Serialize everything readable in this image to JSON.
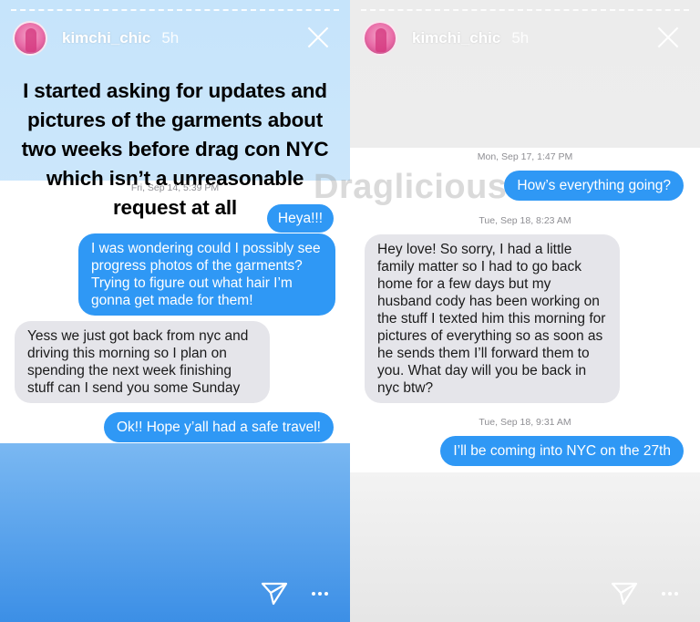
{
  "left": {
    "username": "kimchi_chic",
    "time": "5h",
    "story_text": "I started asking for updates and pictures of the garments about two weeks before drag con NYC which isn’t a unreasonable request at all",
    "timestamp": "Fri, Sep 14, 5:39 PM",
    "messages": [
      {
        "from": "me",
        "text": "Heya!!!"
      },
      {
        "from": "me",
        "text": "I was wondering could I possibly see progress photos of the garments? Trying to figure out what hair I’m gonna get made for them!"
      },
      {
        "from": "them",
        "text": "Yess we just got back from nyc and driving this morning so I plan on spending the next week finishing stuff can I send you some Sunday"
      },
      {
        "from": "me",
        "text": "Ok!! Hope y’all had a safe travel!"
      }
    ]
  },
  "right": {
    "username": "kimchi_chic",
    "time": "5h",
    "timestamps": [
      "Mon, Sep 17, 1:47 PM",
      "Tue, Sep 18, 8:23 AM",
      "Tue, Sep 18, 9:31 AM"
    ],
    "messages": [
      {
        "from": "me",
        "text": "How’s everything going?"
      },
      {
        "from": "them",
        "text": "Hey love! So sorry, I had a little family matter so I had to go back home for a few days but my husband cody has been working on the stuff I texted him this morning for pictures of everything so as soon as he sends them I’ll forward them to you. What day will you be back in nyc btw?"
      },
      {
        "from": "me",
        "text": "I’ll be coming into NYC on the 27th"
      }
    ]
  },
  "watermark": "Draglicious",
  "icons": {
    "close": "close-icon",
    "send": "send-icon",
    "more": "more-icon"
  },
  "colors": {
    "outgoing_bubble": "#2f98f5",
    "incoming_bubble": "#e5e5ea"
  }
}
